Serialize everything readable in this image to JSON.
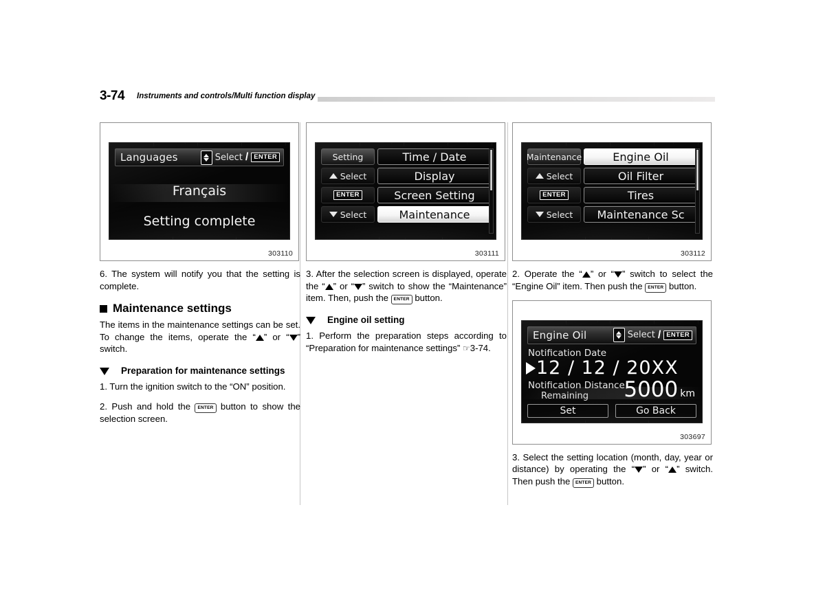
{
  "header": {
    "page_number": "3-74",
    "title": "Instruments and controls/Multi function display"
  },
  "columns": {
    "left": {
      "figure": {
        "id": "303110",
        "screen": {
          "title": "Languages",
          "select_label": "Select",
          "enter_label": "ENTER",
          "language_value": "Français",
          "status_text": "Setting complete"
        }
      },
      "step6": "6. The system will notify you that the setting is complete.",
      "section_heading": "Maintenance settings",
      "section_intro_a": "The items in the maintenance settings can be set. To change the items, operate the “",
      "section_intro_b": "” or “",
      "section_intro_c": "” switch.",
      "sub_heading": "Preparation for maintenance settings",
      "step1": "1. Turn the ignition switch to the “ON” position.",
      "step2_a": "2. Push and hold the ",
      "step2_key": "ENTER",
      "step2_b": " button to show the selection screen."
    },
    "middle": {
      "figure": {
        "id": "303111",
        "screen": {
          "side_title": "Setting",
          "select_up_label": "Select",
          "enter_label": "ENTER",
          "select_down_label": "Select",
          "items": [
            {
              "label": "Time / Date",
              "selected": false
            },
            {
              "label": "Display",
              "selected": false
            },
            {
              "label": "Screen Setting",
              "selected": false
            },
            {
              "label": "Maintenance",
              "selected": true
            }
          ]
        }
      },
      "step3_a": "3. After the selection screen is displayed, operate the “",
      "step3_b": "” or “",
      "step3_c": "” switch to show the “Maintenance” item. Then, push the ",
      "step3_key": "ENTER",
      "step3_d": " button.",
      "sub_heading": "Engine oil setting",
      "step1_a": "1. Perform the preparation steps according to “Preparation for maintenance settings” ",
      "step1_ref_icon": "pointing-hand",
      "step1_ref": "3-74."
    },
    "right": {
      "figure_top": {
        "id": "303112",
        "screen": {
          "side_title": "Maintenance",
          "select_up_label": "Select",
          "enter_label": "ENTER",
          "select_down_label": "Select",
          "items": [
            {
              "label": "Engine Oil",
              "selected": true
            },
            {
              "label": "Oil Filter",
              "selected": false
            },
            {
              "label": "Tires",
              "selected": false
            },
            {
              "label": "Maintenance Sc",
              "selected": false
            }
          ]
        }
      },
      "step2_a": "2. Operate the “",
      "step2_b": "” or “",
      "step2_c": "” switch to select the “Engine Oil” item. Then push the ",
      "step2_key": "ENTER",
      "step2_d": " button.",
      "figure_bottom": {
        "id": "303697",
        "screen": {
          "title": "Engine Oil",
          "select_label": "Select",
          "enter_label": "ENTER",
          "notification_date_label": "Notification Date",
          "date_value": "12  /  12  /  20XX",
          "notification_distance_label": "Notification Distance",
          "remaining_label": "Remaining",
          "distance_value": "5000",
          "distance_unit": "km",
          "set_button": "Set",
          "go_back_button": "Go Back"
        }
      },
      "step3_a": "3. Select the setting location (month, day, year or distance) by operating the “",
      "step3_b": "” or “",
      "step3_c": "” switch. Then push the ",
      "step3_key": "ENTER",
      "step3_d": " button."
    }
  },
  "colors": {
    "screen_background": "#060606",
    "screen_text": "#f4f4f4",
    "selected_item_background": "#ffffff",
    "selected_item_text": "#0a0a0a",
    "header_rule": "#c9c9c9"
  }
}
